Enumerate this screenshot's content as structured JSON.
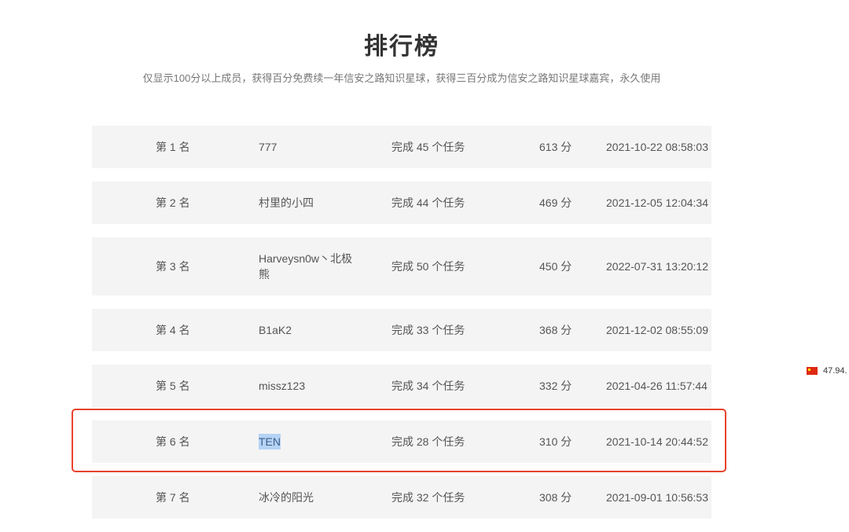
{
  "page": {
    "title": "排行榜",
    "subtitle": "仅显示100分以上成员，获得百分免费续一年信安之路知识星球，获得三百分成为信安之路知识星球嘉宾，永久使用"
  },
  "leaderboard": {
    "rows": [
      {
        "rank": "第 1 名",
        "name": "777",
        "tasks": "完成 45 个任务",
        "score": "613 分",
        "time": "2021-10-22 08:58:03"
      },
      {
        "rank": "第 2 名",
        "name": "村里的小四",
        "tasks": "完成 44 个任务",
        "score": "469 分",
        "time": "2021-12-05 12:04:34"
      },
      {
        "rank": "第 3 名",
        "name": "Harveysn0w丶北极熊",
        "tasks": "完成 50 个任务",
        "score": "450 分",
        "time": "2022-07-31 13:20:12"
      },
      {
        "rank": "第 4 名",
        "name": "B1aK2",
        "tasks": "完成 33 个任务",
        "score": "368 分",
        "time": "2021-12-02 08:55:09"
      },
      {
        "rank": "第 5 名",
        "name": "missz123",
        "tasks": "完成 34 个任务",
        "score": "332 分",
        "time": "2021-04-26 11:57:44"
      },
      {
        "rank": "第 6 名",
        "name": "TEN",
        "tasks": "完成 28 个任务",
        "score": "310 分",
        "time": "2021-10-14 20:44:52"
      },
      {
        "rank": "第 7 名",
        "name": "冰冷的阳光",
        "tasks": "完成 32 个任务",
        "score": "308 分",
        "time": "2021-09-01 10:56:53"
      }
    ]
  },
  "overlay": {
    "ip_text": "47.94.",
    "flag_icon": "china-flag-icon",
    "annotation_color": "#e8432c",
    "selection_color": "#b5d3f5"
  }
}
